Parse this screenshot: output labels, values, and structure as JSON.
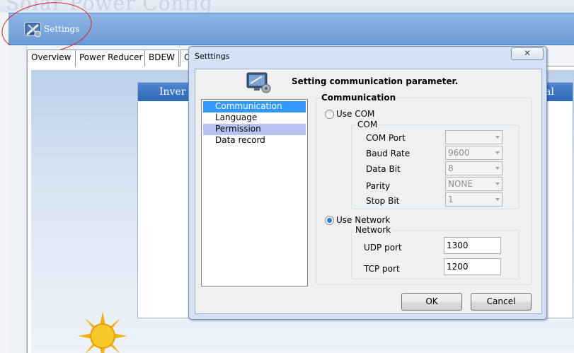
{
  "app": {
    "ghost_title": "Solar Power Config",
    "settings_label": "Settings",
    "tabs": [
      {
        "label": "Overview"
      },
      {
        "label": "Power Reducer"
      },
      {
        "label": "BDEW"
      },
      {
        "label": "C"
      }
    ],
    "inverter_title": "Inver",
    "inverter_title_right": "al"
  },
  "dialog": {
    "title": "Setttings",
    "close_glyph": "✕",
    "header_text": "Setting communication parameter.",
    "nav_items": [
      {
        "label": "Communication",
        "state": "selected"
      },
      {
        "label": "Language",
        "state": "normal"
      },
      {
        "label": "Permission",
        "state": "hover"
      },
      {
        "label": "Data record",
        "state": "normal"
      }
    ],
    "communication": {
      "group_title": "Communication",
      "use_com_label": "Use COM",
      "use_com_checked": false,
      "com_group_title": "COM",
      "com_port_label": "COM Port",
      "com_port_value": "",
      "baud_rate_label": "Baud Rate",
      "baud_rate_value": "9600",
      "data_bit_label": "Data Bit",
      "data_bit_value": "8",
      "parity_label": "Parity",
      "parity_value": "NONE",
      "stop_bit_label": "Stop Bit",
      "stop_bit_value": "1",
      "use_network_label": "Use Network",
      "use_network_checked": true,
      "network_group_title": "Network",
      "udp_port_label": "UDP port",
      "udp_port_value": "1300",
      "tcp_port_label": "TCP port",
      "tcp_port_value": "1200"
    },
    "ok_label": "OK",
    "cancel_label": "Cancel"
  }
}
